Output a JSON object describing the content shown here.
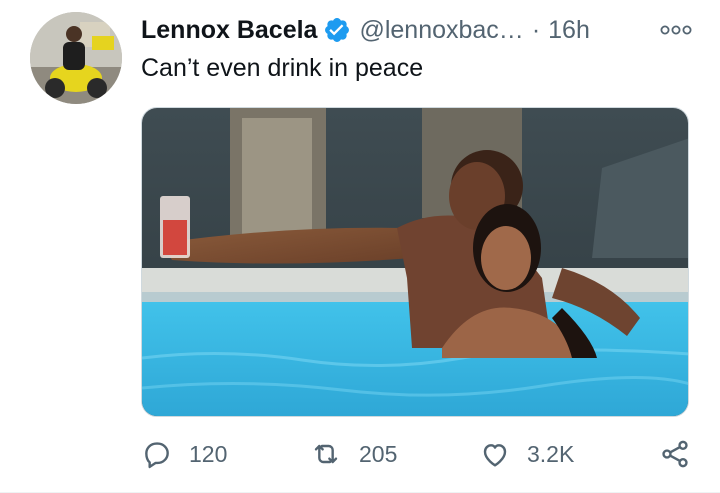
{
  "tweet": {
    "display_name": "Lennox Bacela",
    "verified": true,
    "handle": "@lennoxbac…",
    "separator": "·",
    "time": "16h",
    "text": "Can’t even drink in peace",
    "media": {
      "description_icon": "photo"
    }
  },
  "actions": {
    "reply_count": "120",
    "retweet_count": "205",
    "like_count": "3.2K"
  },
  "colors": {
    "text_primary": "#0f1419",
    "text_secondary": "#536471",
    "verified_blue": "#1d9bf0",
    "pool_blue": "#35b6e0"
  },
  "icons": {
    "more": "more-horizontal-icon",
    "reply": "reply-icon",
    "retweet": "retweet-icon",
    "like": "heart-icon",
    "share": "share-icon",
    "verified": "verified-badge-icon"
  }
}
